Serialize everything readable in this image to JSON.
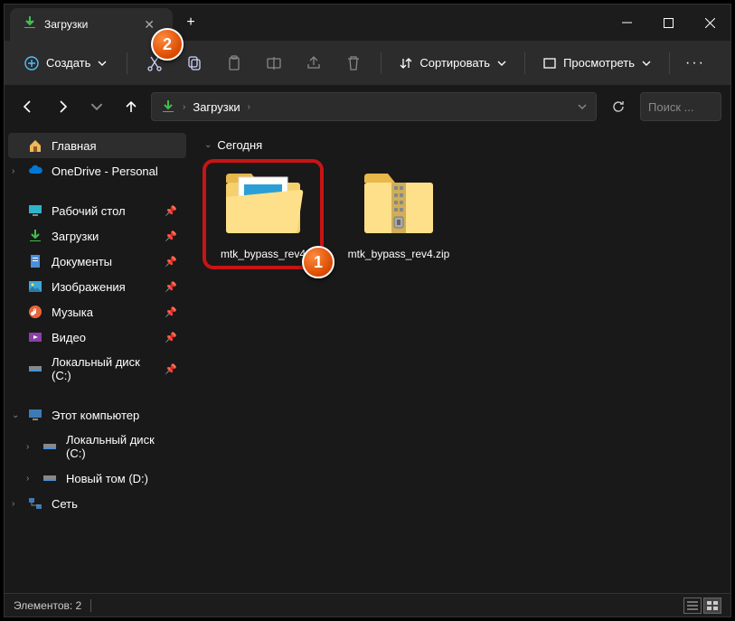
{
  "tab": {
    "title": "Загрузки"
  },
  "toolbar": {
    "create": "Создать",
    "sort": "Сортировать",
    "view": "Просмотреть"
  },
  "breadcrumb": {
    "root": "Загрузки"
  },
  "search": {
    "placeholder": "Поиск ..."
  },
  "sidebar": {
    "home": "Главная",
    "onedrive": "OneDrive - Personal",
    "desktop": "Рабочий стол",
    "downloads": "Загрузки",
    "documents": "Документы",
    "pictures": "Изображения",
    "music": "Музыка",
    "videos": "Видео",
    "localc": "Локальный диск (C:)",
    "thispc": "Этот компьютер",
    "localc2": "Локальный диск (C:)",
    "newvol": "Новый том (D:)",
    "network": "Сеть"
  },
  "group": {
    "today": "Сегодня"
  },
  "files": {
    "folder": "mtk_bypass_rev4",
    "zip": "mtk_bypass_rev4.zip"
  },
  "status": {
    "count": "Элементов: 2"
  },
  "callouts": {
    "one": "1",
    "two": "2"
  }
}
